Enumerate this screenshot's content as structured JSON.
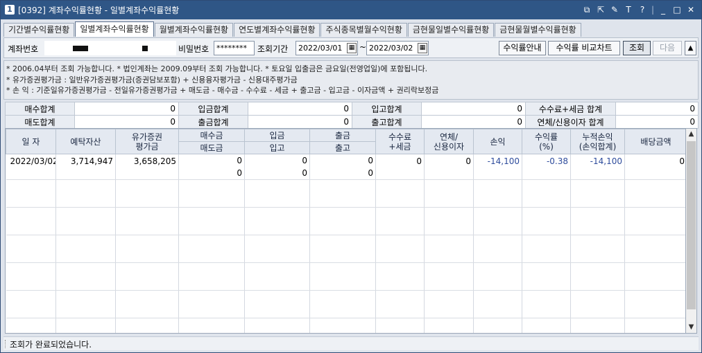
{
  "window": {
    "number": "1",
    "title": "[0392] 계좌수익률현황 - 일별계좌수익률현황",
    "icons": [
      "restore-layout-icon",
      "popout-icon",
      "pin-icon",
      "font-size-icon",
      "help-icon",
      "minimize-icon",
      "maximize-icon",
      "close-icon"
    ],
    "icon_glyphs": [
      "⧉",
      "⇱",
      "✎",
      "T",
      "?",
      "|",
      "_",
      "□",
      "✕"
    ]
  },
  "tabs": [
    {
      "label": "기간별수익률현황",
      "active": false
    },
    {
      "label": "일별계좌수익률현황",
      "active": true
    },
    {
      "label": "월별계좌수익률현황",
      "active": false
    },
    {
      "label": "연도별계좌수익률현황",
      "active": false
    },
    {
      "label": "주식종목별월수익현황",
      "active": false
    },
    {
      "label": "금현물일별수익률현황",
      "active": false
    },
    {
      "label": "금현물월별수익률현황",
      "active": false
    }
  ],
  "toolbar": {
    "account_label": "계좌번호",
    "password_label": "비밀번호",
    "password_value": "********",
    "period_label": "조회기간",
    "date_from": "2022/03/01",
    "tilde": "~",
    "date_to": "2022/03/02",
    "guide_button": "수익률안내",
    "chart_button": "수익률 비교차트",
    "query_button": "조회",
    "next_button": "다음",
    "collapse_glyph": "▲",
    "calendar_glyph": "▦"
  },
  "notes": [
    "* 2006.04부터 조회 가능합니다.   * 법인계좌는 2009.09부터 조회 가능합니다.   * 토요일 입출금은 금요일(전영업일)에 포함됩니다.",
    "* 유가증권평가금 : 일반유가증권평가금(증권담보포함) + 신용융자평가금 - 신용대주평가금",
    "* 손        익 : 기준일유가증권평가금 - 전일유가증권평가금 + 매도금 - 매수금 - 수수료 - 세금 + 출고금 - 입고금 - 이자금액 + 권리락보정금"
  ],
  "summary": [
    [
      {
        "label": "매수합계",
        "value": "0"
      },
      {
        "label": "입금합계",
        "value": "0"
      },
      {
        "label": "입고합계",
        "value": "0"
      },
      {
        "label": "수수료+세금 합계",
        "value": "0"
      }
    ],
    [
      {
        "label": "매도합계",
        "value": "0"
      },
      {
        "label": "출금합계",
        "value": "0"
      },
      {
        "label": "출고합계",
        "value": "0"
      },
      {
        "label": "연체/신용이자 합계",
        "value": "0"
      }
    ]
  ],
  "grid": {
    "headers": {
      "date": "일 자",
      "deposit_assets": "예탁자산",
      "securities_eval": "유가증권\n평가금",
      "buy": "매수금",
      "sell": "매도금",
      "deposit": "입금",
      "stock_in": "입고",
      "withdraw": "출금",
      "stock_out": "출고",
      "fee_tax": "수수료\n+세금",
      "overdue_interest": "연체/\n신용이자",
      "profit": "손익",
      "return_rate": "수익률\n(%)",
      "cum_profit": "누적손익\n(손익합계)",
      "dividend": "배당금액"
    },
    "rows": [
      {
        "date": "2022/03/02",
        "deposit_assets": "3,714,947",
        "securities_eval": "3,658,205",
        "buy": "0",
        "sell": "0",
        "deposit": "0",
        "stock_in": "0",
        "withdraw": "0",
        "stock_out": "0",
        "fee_tax": "0",
        "overdue_interest": "0",
        "profit": "-14,100",
        "return_rate": "-0.38",
        "cum_profit": "-14,100",
        "dividend": "0"
      }
    ],
    "scroll_up": "▲",
    "scroll_down": "▼"
  },
  "status": {
    "message": "조회가 완료되었습니다."
  }
}
